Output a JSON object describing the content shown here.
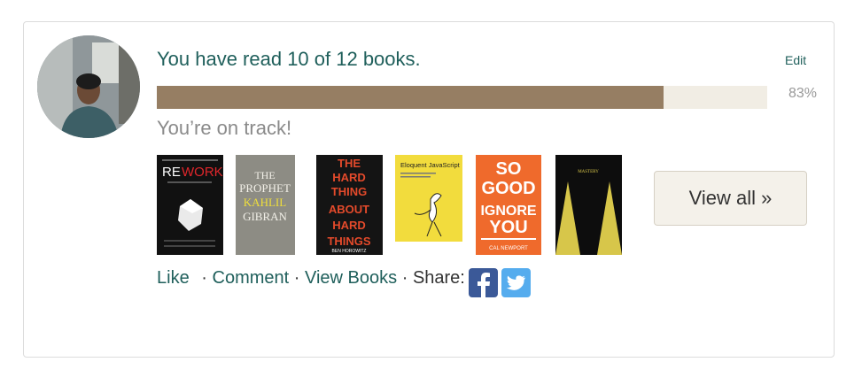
{
  "header": {
    "headline": "You have read 10 of 12 books.",
    "edit_label": "Edit"
  },
  "progress": {
    "fraction": 0.83,
    "percent_label": "83%",
    "status": "You’re on track!"
  },
  "books": [
    {
      "title": "REWORK",
      "title_part1": "RE",
      "title_part2": "WORK"
    },
    {
      "title": "The Prophet",
      "author": "KAHLIL GIBRAN",
      "title_line1": "THE",
      "title_line2": "PROPHET",
      "author_line1": "KAHLIL",
      "author_line2": "GIBRAN"
    },
    {
      "title": "THE HARD THING ABOUT HARD THINGS",
      "lines": [
        "THE",
        "HARD",
        "THING",
        "ABOUT",
        "HARD",
        "THINGS"
      ],
      "author": "BEN HOROWITZ"
    },
    {
      "title": "Eloquent JavaScript"
    },
    {
      "title": "SO GOOD THEY CAN'T IGNORE YOU",
      "lines": [
        "SO",
        "GOOD",
        "IGNORE",
        "YOU"
      ],
      "author": "CAL NEWPORT"
    },
    {
      "title": "MASTERY"
    }
  ],
  "view_all_label": "View all »",
  "actions": {
    "like": "Like",
    "comment": "Comment",
    "view_books": "View Books",
    "share": "Share:",
    "separator": "·"
  },
  "colors": {
    "link": "#1f5f5b",
    "bar_fill": "#967e63",
    "bar_track": "#f1ede4",
    "facebook": "#3b5998",
    "twitter": "#55acee"
  },
  "icons": [
    "facebook-icon",
    "twitter-icon"
  ]
}
